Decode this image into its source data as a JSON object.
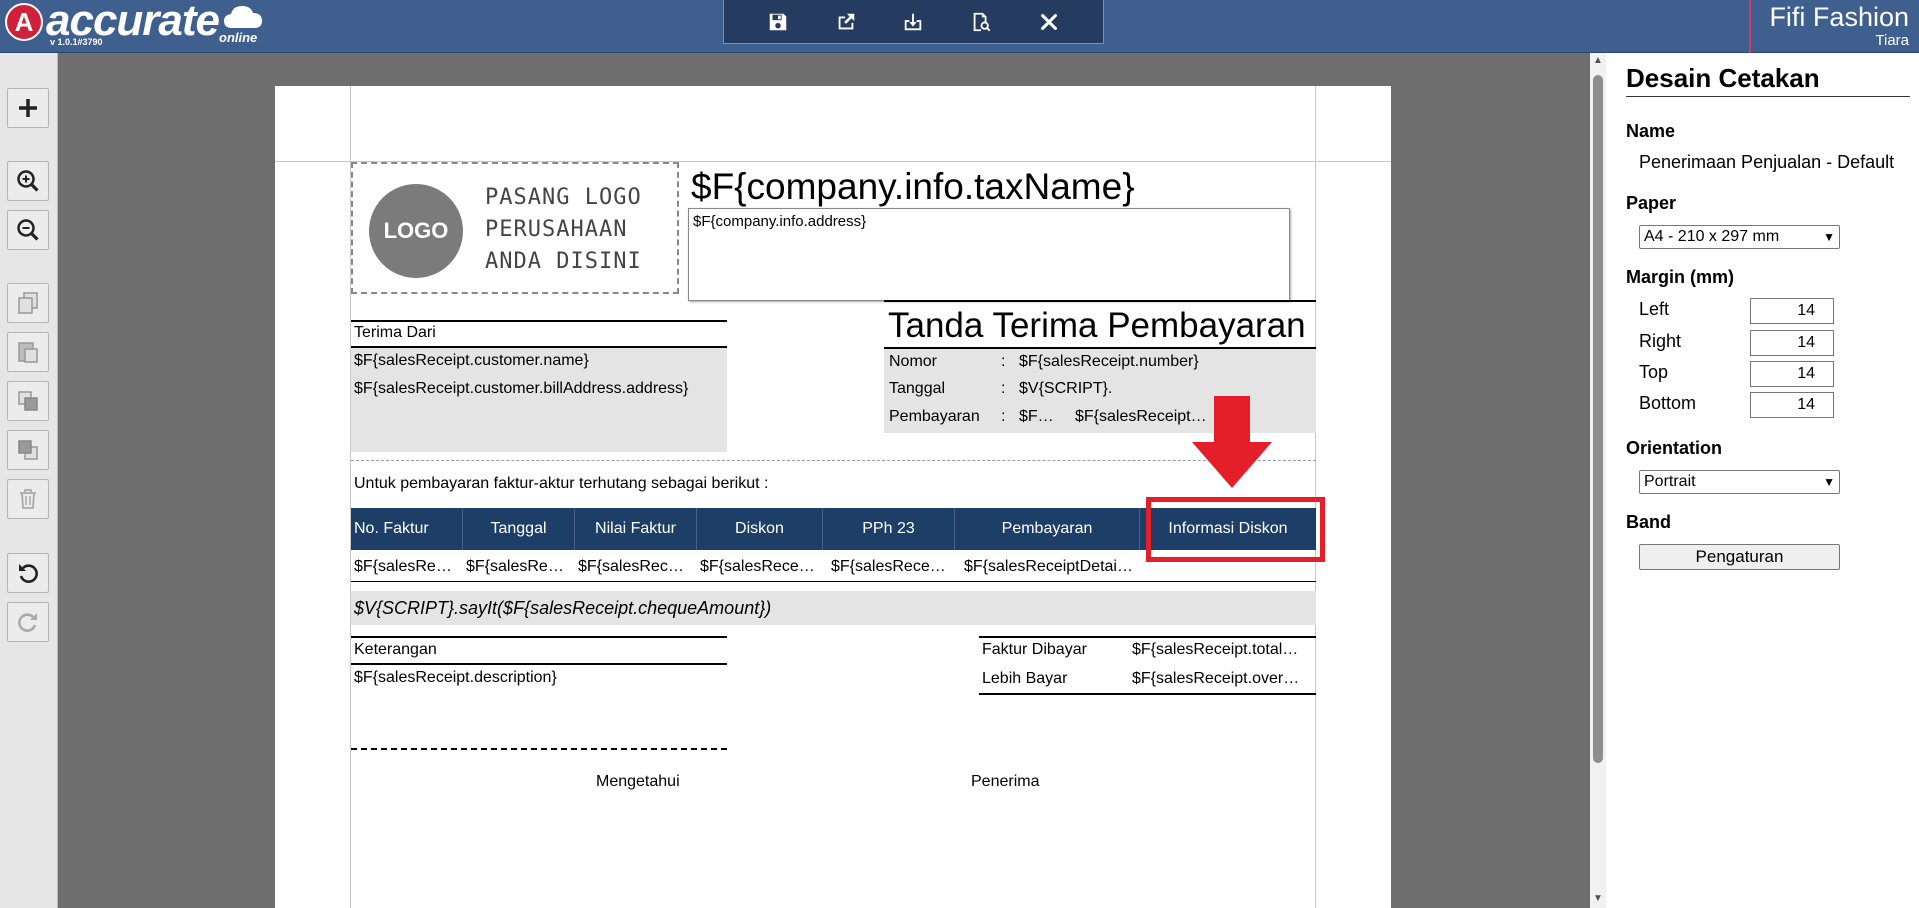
{
  "brand": {
    "name": "accurate",
    "sub": "online",
    "version": "v 1.0.1#3790"
  },
  "company": {
    "name": "Fifi Fashion",
    "user": "Tiara"
  },
  "toolbar": {
    "items": [
      "save-icon",
      "export-icon",
      "import-icon",
      "preview-icon",
      "close-icon"
    ]
  },
  "left_toolbar": {
    "items": [
      "plus-icon",
      "zoom-in-icon",
      "zoom-out-icon",
      "copy-icon",
      "paste-icon",
      "bring-front-icon",
      "send-back-icon",
      "trash-icon",
      "undo-icon",
      "redo-icon"
    ]
  },
  "doc": {
    "logo_text": "LOGO",
    "logo_lines": [
      "PASANG LOGO",
      "PERUSAHAAN",
      "ANDA DISINI"
    ],
    "tax_name": "$F{company.info.taxName}",
    "address": "$F{company.info.address}",
    "receive_from_label": "Terima Dari",
    "customer_name": "$F{salesReceipt.customer.name}",
    "customer_address": "$F{salesReceipt.customer.billAddress.address}",
    "title": "Tanda Terima Pembayaran",
    "info_rows": [
      {
        "label": "Nomor",
        "sep": ":",
        "value": "$F{salesReceipt.number}"
      },
      {
        "label": "Tanggal",
        "sep": ":",
        "value": "$V{SCRIPT}."
      },
      {
        "label": "Pembayaran",
        "sep": ":",
        "value": "$F…",
        "value2": "$F{salesReceipt…"
      }
    ],
    "intro_text": "Untuk pembayaran faktur-aktur terhutang sebagai berikut :",
    "table_headers": [
      "No. Faktur",
      "Tanggal",
      "Nilai Faktur",
      "Diskon",
      "PPh 23",
      "Pembayaran",
      "Informasi Diskon"
    ],
    "table_row": [
      "$F{salesRe…",
      "$F{salesRe…",
      "$F{salesRec…",
      "$F{salesRece…",
      "$F{salesRece…",
      "$F{salesReceiptDetai…",
      ""
    ],
    "say_it": "$V{SCRIPT}.sayIt($F{salesReceipt.chequeAmount})",
    "notes_label": "Keterangan",
    "notes_value": "$F{salesReceipt.description}",
    "totals": [
      {
        "label": "Faktur Dibayar",
        "value": "$F{salesReceipt.total…"
      },
      {
        "label": "Lebih Bayar",
        "value": "$F{salesReceipt.over…"
      }
    ],
    "sign_left": "Mengetahui",
    "sign_right": "Penerima"
  },
  "panel": {
    "title": "Desain Cetakan",
    "name_label": "Name",
    "name_value": "Penerimaan Penjualan - Default",
    "paper_label": "Paper",
    "paper_value": "A4 - 210 x 297 mm",
    "margin_label": "Margin (mm)",
    "margins": [
      {
        "label": "Left",
        "value": "14"
      },
      {
        "label": "Right",
        "value": "14"
      },
      {
        "label": "Top",
        "value": "14"
      },
      {
        "label": "Bottom",
        "value": "14"
      }
    ],
    "orientation_label": "Orientation",
    "orientation_value": "Portrait",
    "band_label": "Band",
    "band_button": "Pengaturan"
  },
  "colors": {
    "topbar": "#3f5f8f",
    "header_row": "#1d3e66",
    "highlight": "#e51f2a"
  }
}
